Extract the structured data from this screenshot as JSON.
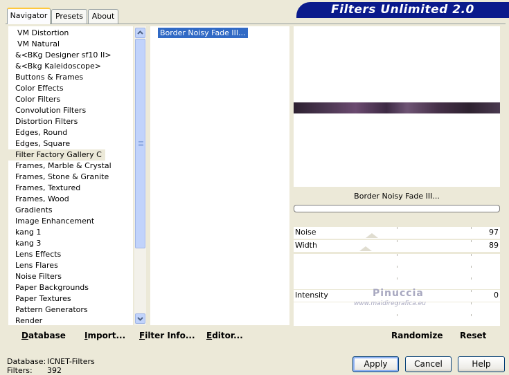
{
  "tabs": [
    {
      "label": "Navigator",
      "active": true
    },
    {
      "label": "Presets",
      "active": false
    },
    {
      "label": "About",
      "active": false
    }
  ],
  "banner": {
    "title": "Filters Unlimited 2.0"
  },
  "categories": [
    "VM Distortion",
    "VM Natural",
    "&<BKg Designer sf10 II>",
    "&<Bkg Kaleidoscope>",
    "Buttons & Frames",
    "Color Effects",
    "Color Filters",
    "Convolution Filters",
    "Distortion Filters",
    "Edges, Round",
    "Edges, Square",
    "Filter Factory Gallery C",
    "Frames, Marble & Crystal",
    "Frames, Stone & Granite",
    "Frames, Textured",
    "Frames, Wood",
    "Gradients",
    "Image Enhancement",
    "kang 1",
    "kang 3",
    "Lens Effects",
    "Lens Flares",
    "Noise Filters",
    "Paper Backgrounds",
    "Paper Textures",
    "Pattern Generators",
    "Render"
  ],
  "selected_category": "Filter Factory Gallery C",
  "filters": [
    "Border Noisy Fade III..."
  ],
  "current_filter": "Border Noisy Fade III...",
  "sliders": [
    {
      "label": "Noise",
      "value": "97",
      "fraction": 0.38
    },
    {
      "label": "Width",
      "value": "89",
      "fraction": 0.35
    },
    {
      "label": "Intensity",
      "value": "0",
      "fraction": 0.0
    }
  ],
  "watermark": {
    "name": "Pinuccia",
    "url": "www.maidiregrafica.eu"
  },
  "left_toolbar": {
    "database": "Database",
    "import": "Import...",
    "filter_info": "Filter Info...",
    "editor": "Editor..."
  },
  "right_toolbar": {
    "randomize": "Randomize",
    "reset": "Reset"
  },
  "status": {
    "database_label": "Database:",
    "database_value": "ICNET-Filters",
    "filters_label": "Filters:",
    "filters_value": "392"
  },
  "dialog_buttons": {
    "apply": "Apply",
    "cancel": "Cancel",
    "help": "Help"
  },
  "colors": {
    "banner": "#0a1a8c",
    "selection": "#316ac5",
    "face": "#ece9d8"
  }
}
